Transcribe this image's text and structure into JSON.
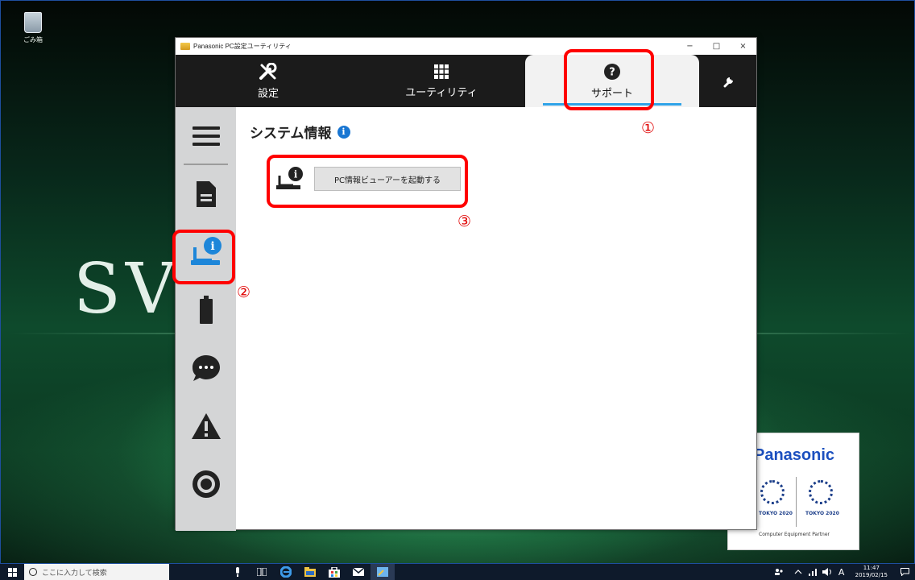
{
  "desktop": {
    "recycle_bin_label": "ごみ箱",
    "wallpaper_text": "SV",
    "partner_card": {
      "brand": "Panasonic",
      "tokyo_left": "TOKYO 2020",
      "tokyo_right": "TOKYO 2020",
      "caption": "Computer Equipment Partner"
    }
  },
  "window": {
    "title": "Panasonic PC設定ユーティリティ",
    "controls": {
      "minimize": "−",
      "maximize": "□",
      "close": "×"
    },
    "tabs": [
      {
        "label": "設定",
        "icon": "tools-icon"
      },
      {
        "label": "ユーティリティ",
        "icon": "grid-icon"
      },
      {
        "label": "サポート",
        "icon": "help-icon",
        "active": true
      },
      {
        "label": "",
        "icon": "wrench-icon"
      }
    ],
    "sidebar": [
      {
        "name": "menu",
        "icon": "hamburger-icon"
      },
      {
        "name": "document",
        "icon": "document-icon"
      },
      {
        "name": "system-info",
        "icon": "laptop-info-icon",
        "active": true
      },
      {
        "name": "battery",
        "icon": "battery-icon"
      },
      {
        "name": "chat",
        "icon": "chat-icon"
      },
      {
        "name": "warning",
        "icon": "warning-icon"
      },
      {
        "name": "target",
        "icon": "target-icon"
      }
    ],
    "content": {
      "section_title": "システム情報",
      "launch_button": "PC情報ビューアーを起動する"
    }
  },
  "annotations": {
    "callout_1": "①",
    "callout_2": "②",
    "callout_3": "③",
    "color": "#ff0000"
  },
  "taskbar": {
    "search_placeholder": "ここに入力して検索",
    "tray_ime": "A",
    "time": "11:47",
    "date": "2019/02/15"
  },
  "colors": {
    "accent": "#2fa3e8",
    "info_blue": "#1976d2",
    "topbar": "#1b1b1b",
    "sidebar": "#d4d5d6"
  }
}
